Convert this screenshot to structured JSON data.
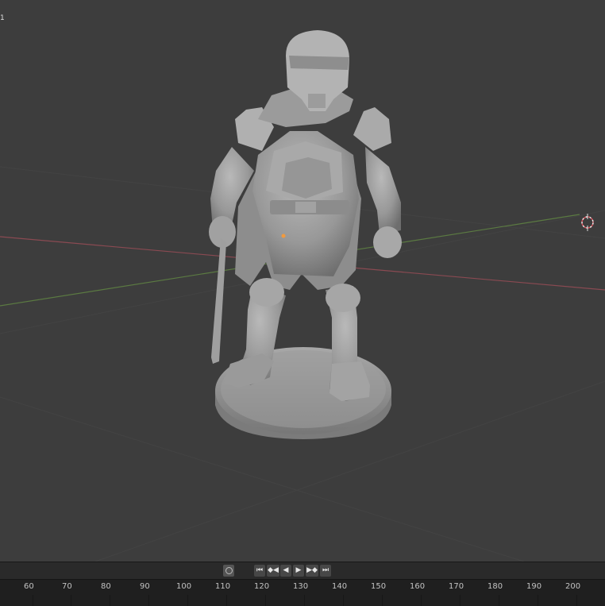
{
  "viewport": {
    "corner_text": "1",
    "background": "#3d3d3d",
    "model": "armored-knight-figure-on-round-base",
    "axis_colors": {
      "x": "#8a4a52",
      "y": "#5b7a42"
    }
  },
  "playback": {
    "record_icon": "record-circle-icon",
    "buttons": [
      {
        "name": "jump-start",
        "glyph": "⏮"
      },
      {
        "name": "jump-keyframe-back",
        "glyph": "◆◀"
      },
      {
        "name": "play-reverse",
        "glyph": "◀"
      },
      {
        "name": "play",
        "glyph": "▶"
      },
      {
        "name": "jump-keyframe-forward",
        "glyph": "▶◆"
      },
      {
        "name": "jump-end",
        "glyph": "⏭"
      }
    ]
  },
  "timeline": {
    "frames": [
      "60",
      "70",
      "80",
      "90",
      "100",
      "110",
      "120",
      "130",
      "140",
      "150",
      "160",
      "170",
      "180",
      "190",
      "200"
    ]
  }
}
